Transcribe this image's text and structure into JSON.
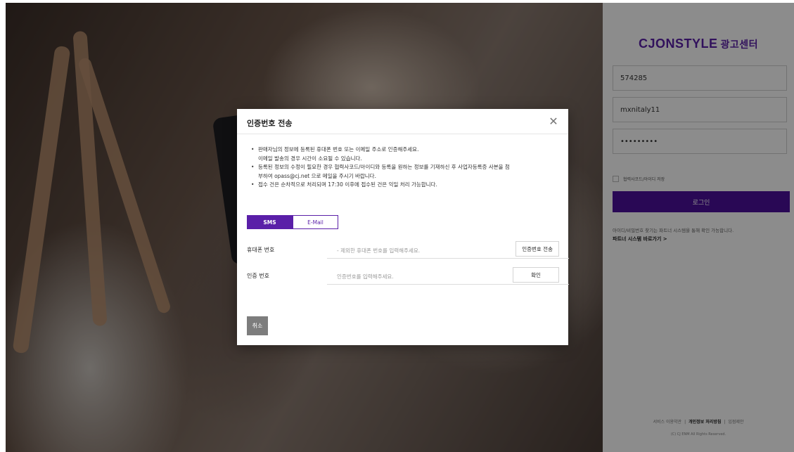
{
  "panel": {
    "brand_main": "CJONSTYLE",
    "brand_sub": "광고센터",
    "partner_code": "574285",
    "user_id": "mxnitaly11",
    "password_mask": "•••••••••",
    "remember_label": "협력사코드/아이디 저장",
    "login_label": "로그인",
    "help_text": "아이디/비밀번호 찾기는 파트너 시스템을 통해 확인 가능합니다.",
    "help_link": "파트너 시스템 바로가기 >",
    "footer": {
      "terms": "서비스 이용약관",
      "privacy": "개인정보 처리방침",
      "join": "입점제안",
      "copyright": "(C) CJ ENM All Rights Reserved."
    }
  },
  "modal": {
    "title": "인증번호 전송",
    "close_icon": "close-icon",
    "notice": [
      "판매자님의 정보에 등록된 휴대폰 번호 또는 이메일 주소로 인증해주세요.",
      "이메일 발송의 경우 시간이 소요될 수 있습니다.",
      "등록된 정보의 수정이 필요한 경우 협력사코드/아이디와 등록을 원하는 정보를 기재하신 후 사업자등록증 사본을 첨",
      "부하여 opass@cj.net 으로 메일을 주시기 바랍니다.",
      "접수 건은 순차적으로 처리되며 17:30 이후에 접수된 건은 익일 처리 가능합니다."
    ],
    "tabs": [
      {
        "label": "SMS",
        "active": true
      },
      {
        "label": "E-Mail",
        "active": false
      }
    ],
    "phone_row": {
      "label": "휴대폰 번호",
      "placeholder": "- 제외한 휴대폰 번호를 입력해주세요.",
      "button": "인증번호 전송"
    },
    "code_row": {
      "label": "인증 번호",
      "placeholder": "인증번호를 입력해주세요.",
      "button": "확인"
    },
    "cancel_label": "취소"
  },
  "colors": {
    "brand": "#5a1fa8",
    "login_button": "#4b0f9c",
    "cancel_button": "#7d7d7d"
  }
}
